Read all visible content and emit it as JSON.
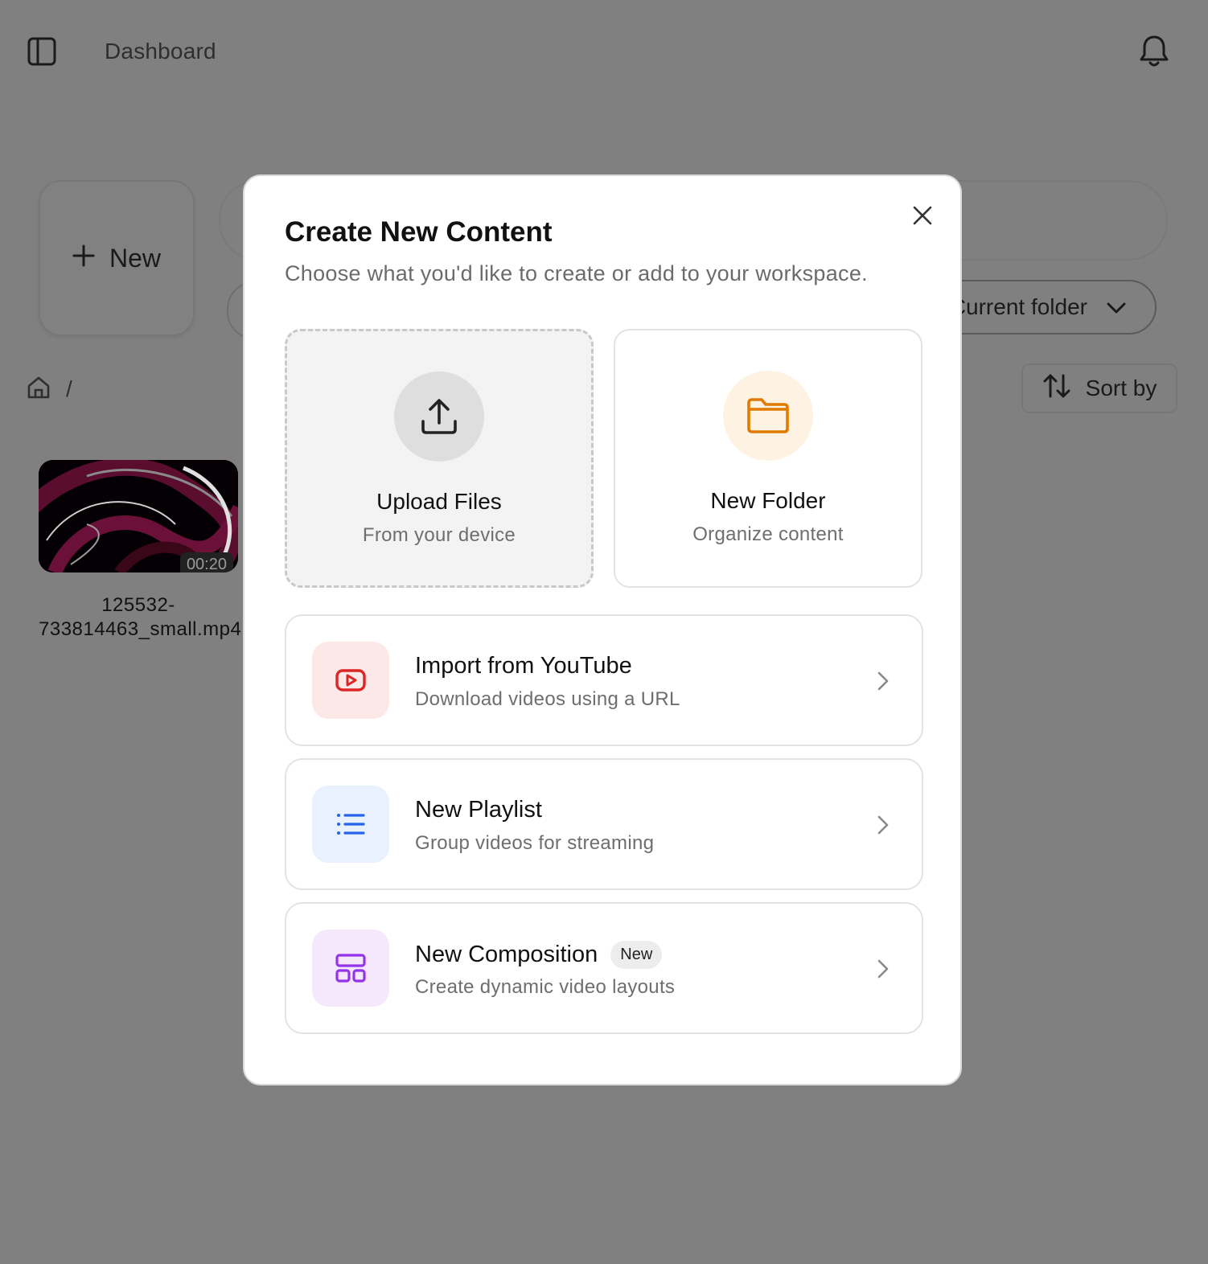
{
  "topbar": {
    "breadcrumb": "Dashboard"
  },
  "toolbar": {
    "new_label": "New",
    "folder_select_value": "Current folder",
    "sort_label": "Sort by",
    "path_separator": "/"
  },
  "files": [
    {
      "name": "125532-733814463_small.mp4",
      "duration": "00:20"
    }
  ],
  "modal": {
    "title": "Create New Content",
    "subtitle": "Choose what you'd like to create or add to your workspace.",
    "tiles": [
      {
        "title": "Upload Files",
        "subtitle": "From your device",
        "icon": "upload-icon"
      },
      {
        "title": "New Folder",
        "subtitle": "Organize content",
        "icon": "folder-icon"
      }
    ],
    "rows": [
      {
        "title": "Import from YouTube",
        "subtitle": "Download videos using a URL",
        "icon": "youtube-icon",
        "icon_color": "#dc2626",
        "icon_bg": "#fde8e8"
      },
      {
        "title": "New Playlist",
        "subtitle": "Group videos for streaming",
        "icon": "list-icon",
        "icon_color": "#2563eb",
        "icon_bg": "#e8f1fd"
      },
      {
        "title": "New Composition",
        "subtitle": "Create dynamic video layouts",
        "badge": "New",
        "icon": "layout-icon",
        "icon_color": "#9333ea",
        "icon_bg": "#f5e8fd"
      }
    ]
  },
  "colors": {
    "overlay": "#808080",
    "upload_accent": "#222222",
    "folder_accent": "#e07b00"
  }
}
